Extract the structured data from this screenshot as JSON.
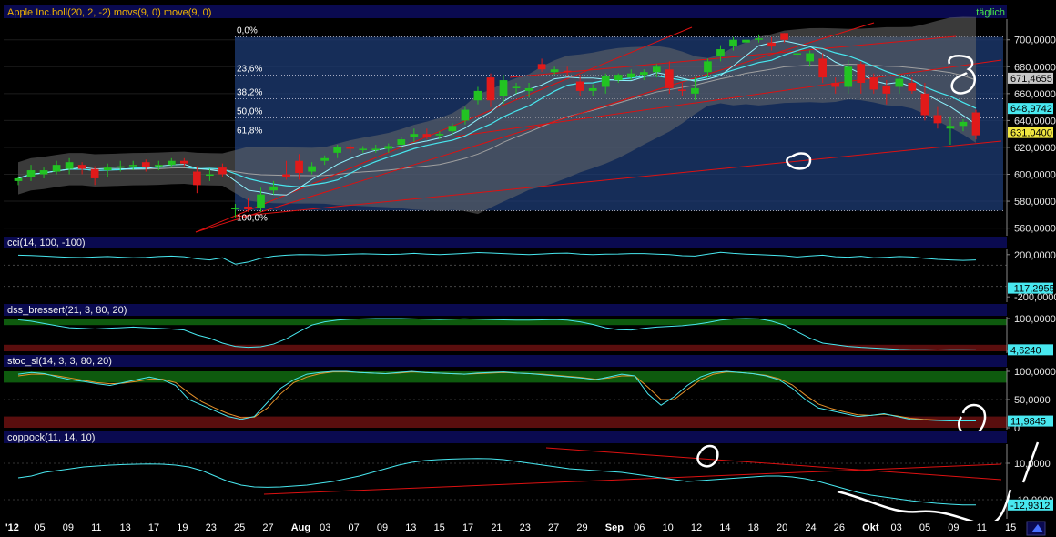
{
  "header": {
    "instrument": "Apple Inc.",
    "indicators": "boll(20, 2, -2) movs(9, 0) move(9, 0)",
    "period": "täglich"
  },
  "colors": {
    "background": "#000000",
    "panel_title_bg": "#0a0a50",
    "up_candle": "#22c322",
    "down_candle": "#e11a1a",
    "ma_line": "#48e8f0",
    "trend_line": "#dd1111",
    "fib_zone": "#1e3f7a",
    "bollinger_band": "#6a6a6a",
    "overbought_zone": "#0e5a0e",
    "oversold_zone": "#5a0e0e",
    "stoch_signal": "#e8922a"
  },
  "fibonacci": {
    "levels": [
      "0,0%",
      "23,6%",
      "38,2%",
      "50,0%",
      "61,8%",
      "100,0%"
    ],
    "prices": [
      702.1,
      673.7,
      656.19,
      641.96,
      627.76,
      573.0
    ]
  },
  "price_axis": {
    "ticks": [
      "700,0000",
      "680,0000",
      "660,0000",
      "640,0000",
      "620,0000",
      "600,0000",
      "580,0000",
      "560,0000"
    ],
    "values": [
      700,
      680,
      660,
      640,
      620,
      600,
      580,
      560
    ],
    "badges": [
      {
        "text": "671,4655",
        "value": 671.4655,
        "color": "#c8c8c8"
      },
      {
        "text": "648,9742",
        "value": 648.9742,
        "color": "#48e8f0"
      },
      {
        "text": "631,0400",
        "value": 631.04,
        "color": "#f0e640"
      }
    ]
  },
  "dates": {
    "labels": [
      "'12",
      "05",
      "09",
      "11",
      "13",
      "17",
      "19",
      "23",
      "25",
      "27",
      "Aug",
      "03",
      "07",
      "09",
      "13",
      "15",
      "17",
      "21",
      "23",
      "27",
      "29",
      "Sep",
      "06",
      "10",
      "12",
      "14",
      "18",
      "20",
      "24",
      "26",
      "Okt",
      "03",
      "05",
      "09",
      "11",
      "15"
    ]
  },
  "panels": [
    {
      "id": "cci",
      "title": "cci(14, 100, -100)",
      "ticks": [
        "200,0000",
        "-200,0000"
      ],
      "value_badge": "-117,2955",
      "value_color": "#48e8f0"
    },
    {
      "id": "dss",
      "title": "dss_bressert(21, 3, 80, 20)",
      "ticks": [
        "100,0000",
        "0"
      ],
      "value_badge": "4,6240",
      "value_color": "#48e8f0"
    },
    {
      "id": "stoc",
      "title": "stoc_sl(14, 3, 3, 80, 20)",
      "ticks": [
        "100,0000",
        "50,0000",
        "0"
      ],
      "value_badge": "11,9845",
      "value_color": "#48e8f0"
    },
    {
      "id": "coppock",
      "title": "coppock(11, 14, 10)",
      "ticks": [
        "10,0000",
        "-10,0000"
      ],
      "value_badge": "-12,9312",
      "value_color": "#48e8f0"
    }
  ],
  "chart_data": [
    {
      "type": "candlestick",
      "title": "Apple Inc.",
      "yaxis": [
        555,
        712
      ],
      "candles": [
        {
          "o": 595,
          "h": 598,
          "l": 592,
          "c": 597
        },
        {
          "o": 598,
          "h": 607,
          "l": 595,
          "c": 603
        },
        {
          "o": 600,
          "h": 605,
          "l": 597,
          "c": 603
        },
        {
          "o": 602,
          "h": 610,
          "l": 600,
          "c": 607
        },
        {
          "o": 604,
          "h": 612,
          "l": 600,
          "c": 609
        },
        {
          "o": 607,
          "h": 609,
          "l": 600,
          "c": 604
        },
        {
          "o": 604,
          "h": 606,
          "l": 592,
          "c": 597
        },
        {
          "o": 603,
          "h": 608,
          "l": 598,
          "c": 605
        },
        {
          "o": 605,
          "h": 610,
          "l": 602,
          "c": 606
        },
        {
          "o": 606,
          "h": 610,
          "l": 603,
          "c": 607
        },
        {
          "o": 609,
          "h": 611,
          "l": 602,
          "c": 605
        },
        {
          "o": 607,
          "h": 610,
          "l": 603,
          "c": 607
        },
        {
          "o": 607,
          "h": 612,
          "l": 605,
          "c": 610
        },
        {
          "o": 610,
          "h": 612,
          "l": 606,
          "c": 608
        },
        {
          "o": 602,
          "h": 606,
          "l": 586,
          "c": 592
        },
        {
          "o": 599,
          "h": 604,
          "l": 595,
          "c": 600
        },
        {
          "o": 605,
          "h": 608,
          "l": 598,
          "c": 600
        },
        {
          "o": 574,
          "h": 578,
          "l": 568,
          "c": 575
        },
        {
          "o": 576,
          "h": 582,
          "l": 572,
          "c": 574
        },
        {
          "o": 575,
          "h": 590,
          "l": 572,
          "c": 585
        },
        {
          "o": 588,
          "h": 595,
          "l": 585,
          "c": 591
        },
        {
          "o": 600,
          "h": 610,
          "l": 596,
          "c": 598
        },
        {
          "o": 610,
          "h": 615,
          "l": 596,
          "c": 601
        },
        {
          "o": 602,
          "h": 609,
          "l": 600,
          "c": 606
        },
        {
          "o": 610,
          "h": 614,
          "l": 607,
          "c": 612
        },
        {
          "o": 616,
          "h": 622,
          "l": 612,
          "c": 620
        },
        {
          "o": 620,
          "h": 622,
          "l": 616,
          "c": 619
        },
        {
          "o": 618,
          "h": 621,
          "l": 616,
          "c": 619
        },
        {
          "o": 618,
          "h": 622,
          "l": 616,
          "c": 619
        },
        {
          "o": 619,
          "h": 623,
          "l": 616,
          "c": 621
        },
        {
          "o": 622,
          "h": 628,
          "l": 619,
          "c": 626
        },
        {
          "o": 628,
          "h": 634,
          "l": 624,
          "c": 630
        },
        {
          "o": 630,
          "h": 634,
          "l": 626,
          "c": 628
        },
        {
          "o": 629,
          "h": 632,
          "l": 626,
          "c": 630
        },
        {
          "o": 632,
          "h": 638,
          "l": 629,
          "c": 636
        },
        {
          "o": 640,
          "h": 650,
          "l": 637,
          "c": 648
        },
        {
          "o": 655,
          "h": 665,
          "l": 652,
          "c": 662
        },
        {
          "o": 672,
          "h": 675,
          "l": 650,
          "c": 655
        },
        {
          "o": 658,
          "h": 674,
          "l": 652,
          "c": 670
        },
        {
          "o": 664,
          "h": 668,
          "l": 660,
          "c": 665
        },
        {
          "o": 662,
          "h": 668,
          "l": 657,
          "c": 664
        },
        {
          "o": 682,
          "h": 686,
          "l": 676,
          "c": 678
        },
        {
          "o": 676,
          "h": 680,
          "l": 674,
          "c": 678
        },
        {
          "o": 677,
          "h": 680,
          "l": 673,
          "c": 676
        },
        {
          "o": 669,
          "h": 674,
          "l": 658,
          "c": 662
        },
        {
          "o": 662,
          "h": 667,
          "l": 658,
          "c": 664
        },
        {
          "o": 665,
          "h": 675,
          "l": 660,
          "c": 673
        },
        {
          "o": 670,
          "h": 675,
          "l": 668,
          "c": 674
        },
        {
          "o": 672,
          "h": 678,
          "l": 670,
          "c": 675
        },
        {
          "o": 674,
          "h": 678,
          "l": 670,
          "c": 676
        },
        {
          "o": 676,
          "h": 682,
          "l": 672,
          "c": 680
        },
        {
          "o": 678,
          "h": 684,
          "l": 660,
          "c": 664
        },
        {
          "o": 663,
          "h": 668,
          "l": 658,
          "c": 662
        },
        {
          "o": 660,
          "h": 672,
          "l": 655,
          "c": 664
        },
        {
          "o": 676,
          "h": 686,
          "l": 672,
          "c": 684
        },
        {
          "o": 688,
          "h": 696,
          "l": 684,
          "c": 693
        },
        {
          "o": 695,
          "h": 702,
          "l": 692,
          "c": 700
        },
        {
          "o": 698,
          "h": 703,
          "l": 696,
          "c": 700
        },
        {
          "o": 700,
          "h": 704,
          "l": 698,
          "c": 701
        },
        {
          "o": 698,
          "h": 702,
          "l": 692,
          "c": 695
        },
        {
          "o": 705,
          "h": 705,
          "l": 698,
          "c": 700
        },
        {
          "o": 690,
          "h": 697,
          "l": 686,
          "c": 690
        },
        {
          "o": 684,
          "h": 692,
          "l": 680,
          "c": 690
        },
        {
          "o": 686,
          "h": 690,
          "l": 668,
          "c": 672
        },
        {
          "o": 668,
          "h": 672,
          "l": 660,
          "c": 665
        },
        {
          "o": 665,
          "h": 685,
          "l": 660,
          "c": 680
        },
        {
          "o": 682,
          "h": 684,
          "l": 660,
          "c": 668
        },
        {
          "o": 672,
          "h": 675,
          "l": 660,
          "c": 663
        },
        {
          "o": 666,
          "h": 670,
          "l": 652,
          "c": 660
        },
        {
          "o": 665,
          "h": 675,
          "l": 660,
          "c": 671
        },
        {
          "o": 668,
          "h": 672,
          "l": 660,
          "c": 662
        },
        {
          "o": 660,
          "h": 668,
          "l": 640,
          "c": 644
        },
        {
          "o": 644,
          "h": 650,
          "l": 634,
          "c": 638
        },
        {
          "o": 634,
          "h": 643,
          "l": 622,
          "c": 636
        },
        {
          "o": 636,
          "h": 641,
          "l": 632,
          "c": 639
        },
        {
          "o": 646,
          "h": 648,
          "l": 626,
          "c": 629
        }
      ],
      "cci": [
        195,
        192,
        186,
        180,
        175,
        172,
        178,
        182,
        176,
        170,
        174,
        182,
        186,
        180,
        160,
        150,
        170,
        110,
        130,
        165,
        185,
        195,
        200,
        199,
        196,
        200,
        205,
        208,
        205,
        202,
        205,
        212,
        205,
        200,
        206,
        212,
        220,
        215,
        210,
        205,
        200,
        206,
        212,
        214,
        205,
        200,
        205,
        206,
        210,
        210,
        205,
        200,
        190,
        186,
        205,
        222,
        212,
        205,
        200,
        195,
        190,
        178,
        188,
        195,
        180,
        176,
        184,
        170,
        175,
        182,
        178,
        165,
        155,
        150,
        145,
        150
      ],
      "dss": [
        96,
        92,
        85,
        78,
        72,
        70,
        68,
        70,
        72,
        74,
        72,
        70,
        68,
        65,
        50,
        40,
        25,
        15,
        12,
        14,
        22,
        38,
        60,
        80,
        90,
        95,
        98,
        99,
        100,
        100,
        100,
        99,
        98,
        97,
        98,
        99,
        98,
        97,
        96,
        95,
        95,
        96,
        97,
        95,
        90,
        82,
        72,
        66,
        65,
        70,
        74,
        76,
        78,
        82,
        88,
        95,
        99,
        100,
        99,
        92,
        80,
        60,
        40,
        25,
        20,
        15,
        12,
        10,
        8,
        6,
        5,
        5,
        4,
        5,
        5,
        4.6
      ],
      "stoch_k": [
        95,
        98,
        96,
        90,
        85,
        82,
        78,
        75,
        80,
        85,
        90,
        85,
        75,
        50,
        40,
        30,
        20,
        15,
        20,
        45,
        70,
        85,
        95,
        98,
        100,
        100,
        98,
        97,
        96,
        98,
        100,
        98,
        97,
        96,
        95,
        97,
        98,
        99,
        97,
        96,
        94,
        92,
        90,
        88,
        85,
        90,
        95,
        92,
        60,
        40,
        55,
        75,
        90,
        98,
        100,
        98,
        96,
        92,
        85,
        70,
        50,
        35,
        30,
        25,
        20,
        22,
        25,
        20,
        15,
        14,
        13,
        12,
        12,
        12
      ],
      "stoch_d": [
        92,
        95,
        95,
        92,
        88,
        84,
        80,
        78,
        79,
        82,
        86,
        86,
        80,
        62,
        46,
        35,
        25,
        18,
        19,
        35,
        60,
        80,
        90,
        96,
        99,
        99,
        98,
        97,
        96,
        97,
        99,
        98,
        97,
        96,
        95,
        96,
        97,
        98,
        97,
        96,
        95,
        93,
        91,
        89,
        86,
        88,
        92,
        92,
        72,
        50,
        50,
        68,
        85,
        95,
        99,
        98,
        96,
        93,
        87,
        76,
        58,
        42,
        34,
        28,
        23,
        22,
        24,
        21,
        17,
        15,
        14,
        13,
        12,
        12
      ],
      "coppock": [
        2,
        3,
        5,
        6,
        7,
        8,
        8.5,
        9,
        9.3,
        9.5,
        9.6,
        9.5,
        9,
        8,
        6,
        3,
        0,
        -2,
        -3,
        -3.2,
        -3,
        -2.5,
        -2,
        -1,
        0,
        1.5,
        3,
        5,
        7,
        9,
        10.5,
        11.5,
        12,
        12.3,
        12.5,
        12.6,
        12.5,
        12,
        11,
        10,
        9,
        8,
        7,
        6.5,
        6,
        5.5,
        5,
        4,
        3,
        2,
        1,
        0,
        0.5,
        1,
        1.5,
        2,
        2.5,
        3,
        3,
        2.5,
        1.5,
        0,
        -2,
        -4,
        -6,
        -7.5,
        -8.5,
        -9.5,
        -10.5,
        -11.3,
        -12,
        -12.5,
        -12.9,
        -12.9
      ]
    }
  ]
}
